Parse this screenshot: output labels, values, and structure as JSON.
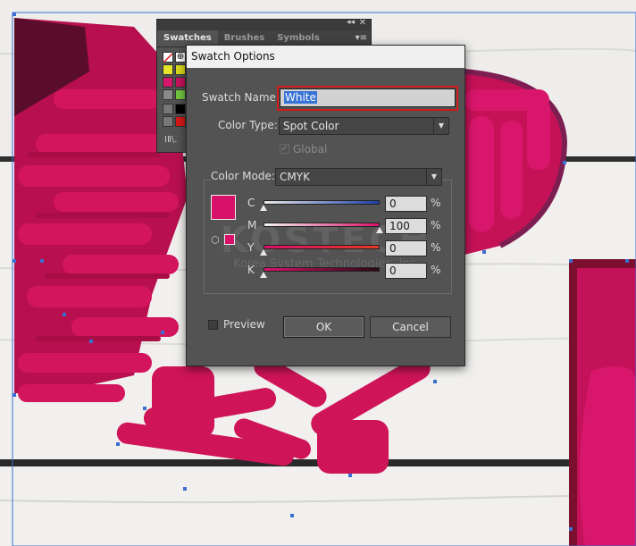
{
  "panel": {
    "tabs": [
      {
        "label": "Swatches"
      },
      {
        "label": "Brushes"
      },
      {
        "label": "Symbols"
      }
    ],
    "collapse_glyph": "◂◂",
    "close_glyph": "✕",
    "menu_glyph": "▾≡",
    "library_glyph": "ⅠⅡ\\.",
    "swatch_colors": [
      "#ffffff",
      "#000000",
      "#e7e52b",
      "#d8d81b",
      "#d6166a",
      "#c4125c",
      "#8a8a8a",
      "#72c442",
      "#000000",
      "#d51818"
    ]
  },
  "dialog": {
    "title": "Swatch Options",
    "swatch_name_label": "Swatch Name:",
    "swatch_name_value": "White",
    "color_type_label": "Color Type:",
    "color_type_value": "Spot Color",
    "global_label": "Global",
    "global_checked": true,
    "color_mode_label": "Color Mode:",
    "color_mode_value": "CMYK",
    "preview_color": "#d8126a",
    "channels": [
      {
        "label": "C",
        "value": "0",
        "unit": "%",
        "level": 0
      },
      {
        "label": "M",
        "value": "100",
        "unit": "%",
        "level": 100
      },
      {
        "label": "Y",
        "value": "0",
        "unit": "%",
        "level": 0
      },
      {
        "label": "K",
        "value": "0",
        "unit": "%",
        "level": 0
      }
    ],
    "preview_label": "Preview",
    "preview_checked": false,
    "ok_label": "OK",
    "cancel_label": "Cancel"
  },
  "watermark": {
    "line1": "KOSTECH",
    "line2": "Korea System Technologies, Inc."
  },
  "colors": {
    "accent_highlight": "#d11a1a",
    "magenta": "#d8126a",
    "dialog_bg": "#535353"
  }
}
